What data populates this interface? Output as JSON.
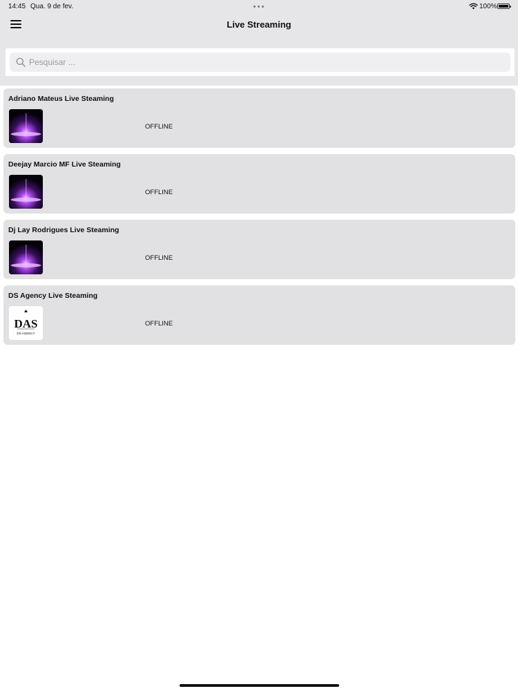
{
  "status_bar": {
    "time": "14:45",
    "date": "Qua. 9 de fev.",
    "battery": "100%"
  },
  "header": {
    "title": "Live Streaming"
  },
  "search": {
    "placeholder": "Pesquisar ..."
  },
  "streams": [
    {
      "name": "Adriano Mateus Live Steaming",
      "status": "OFFLINE",
      "thumbnail": "purple-light-image"
    },
    {
      "name": "Deejay Marcio MF Live Steaming",
      "status": "OFFLINE",
      "thumbnail": "purple-light-image"
    },
    {
      "name": "Dj Lay Rodrigues Live Steaming",
      "status": "OFFLINE",
      "thumbnail": "purple-light-image"
    },
    {
      "name": "DS Agency Live Steaming",
      "status": "OFFLINE",
      "thumbnail": "ds-agency-logo"
    }
  ],
  "logo": {
    "ds_monogram": "DAS",
    "ds_caption": "DS AGENCY"
  },
  "colors": {
    "header_bg": "#e6e5e8",
    "card_bg": "#e1e0e3",
    "glow": "#c060ff"
  }
}
